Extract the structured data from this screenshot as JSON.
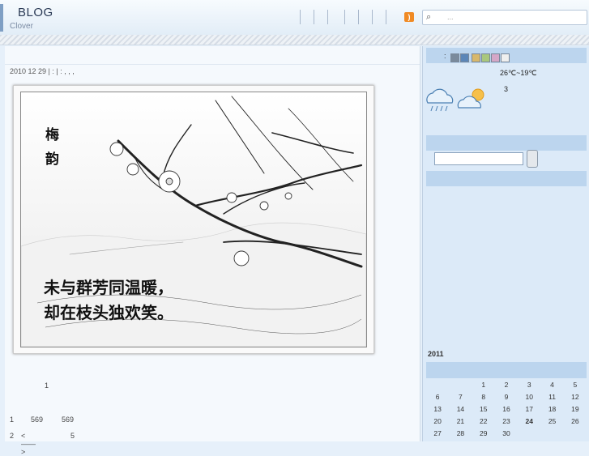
{
  "header": {
    "title": "BLOG",
    "subtitle": "Clover",
    "search_placeholder": "..."
  },
  "post": {
    "meta": "2010 12 29 | :   | :  ,  ,  ,",
    "poem": {
      "title_chars": [
        "梅",
        "韵"
      ],
      "line1": "未与群芳同温暖，",
      "line2": "却在枝头独欢笑。"
    },
    "count": "1",
    "stats": [
      {
        "a": "1",
        "b": "569",
        "c": "569"
      },
      {
        "a": "2",
        "b": "<——>",
        "c": "5"
      }
    ]
  },
  "sidebar": {
    "theme_label": ":",
    "theme_colors": [
      "#7a8a9c",
      "#5b86b8",
      "#d8b86c",
      "#a9c77d",
      "#d5a7c7",
      "#efefef"
    ],
    "temperature": "26℃~19℃",
    "temp_sub": "3",
    "calendar": {
      "year": "2011",
      "weeks": [
        [
          "",
          "",
          "1",
          "2",
          "3",
          "4",
          "5"
        ],
        [
          "6",
          "7",
          "8",
          "9",
          "10",
          "11",
          "12"
        ],
        [
          "13",
          "14",
          "15",
          "16",
          "17",
          "18",
          "19"
        ],
        [
          "20",
          "21",
          "22",
          "23",
          "24",
          "25",
          "26"
        ],
        [
          "27",
          "28",
          "29",
          "30",
          "",
          "",
          ""
        ]
      ],
      "today": "24"
    }
  }
}
